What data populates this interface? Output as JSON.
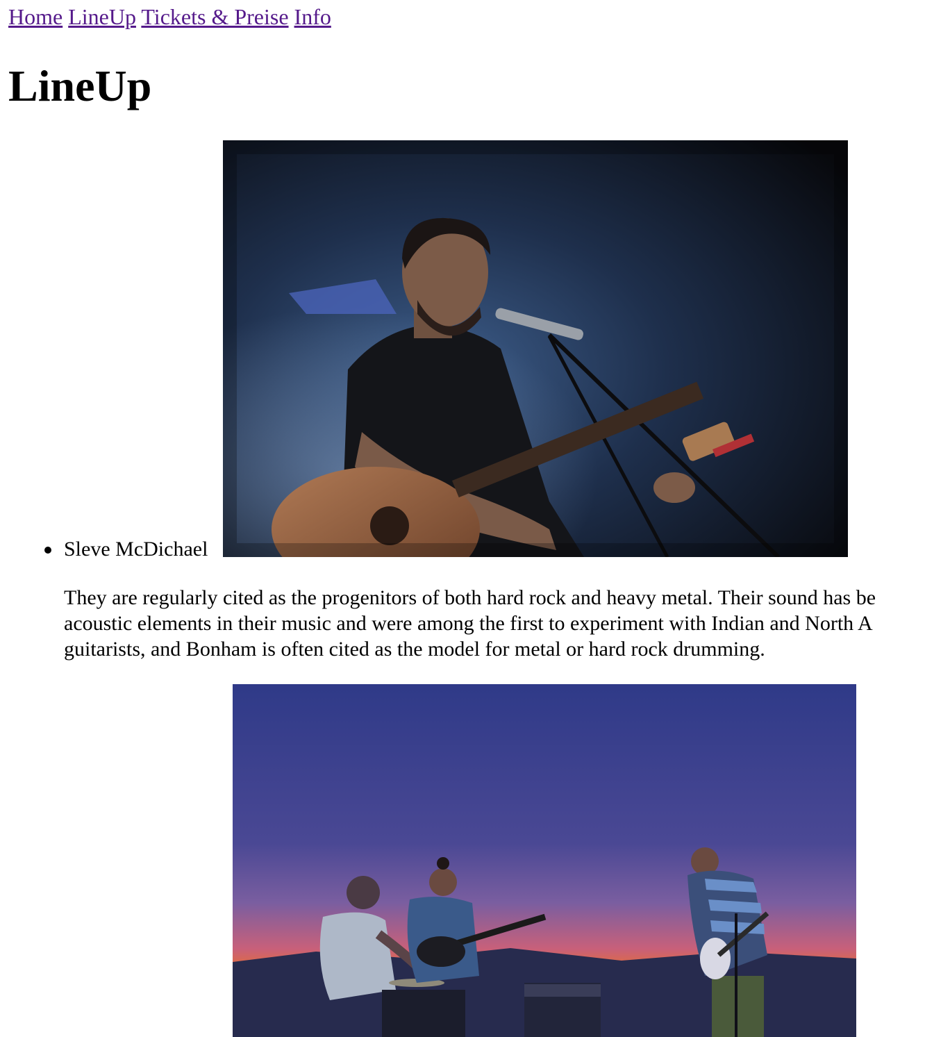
{
  "nav": {
    "links": [
      "Home",
      "LineUp",
      "Tickets & Preise",
      "Info"
    ]
  },
  "page": {
    "title": "LineUp"
  },
  "lineup": {
    "items": [
      {
        "name": "Sleve McDichael",
        "photo": "acoustic guitarist singing into microphone on stage with blue light",
        "bio_lines": [
          "They are regularly cited as the progenitors of both hard rock and heavy metal. Their sound has be",
          "acoustic elements in their music and were among the first to experiment with Indian and North A",
          "guitarists, and Bonham is often cited as the model for metal or hard rock drumming."
        ]
      },
      {
        "photo": "band of three playing outdoors at sunset with drums and guitars"
      }
    ]
  },
  "colors": {
    "link_visited": "#551a8b",
    "stage_blue": "#1c2a44",
    "sunset_orange": "#e0662a",
    "sky_purple": "#3b3f8a"
  },
  "icons": {
    "list_marker": "bullet-icon"
  }
}
